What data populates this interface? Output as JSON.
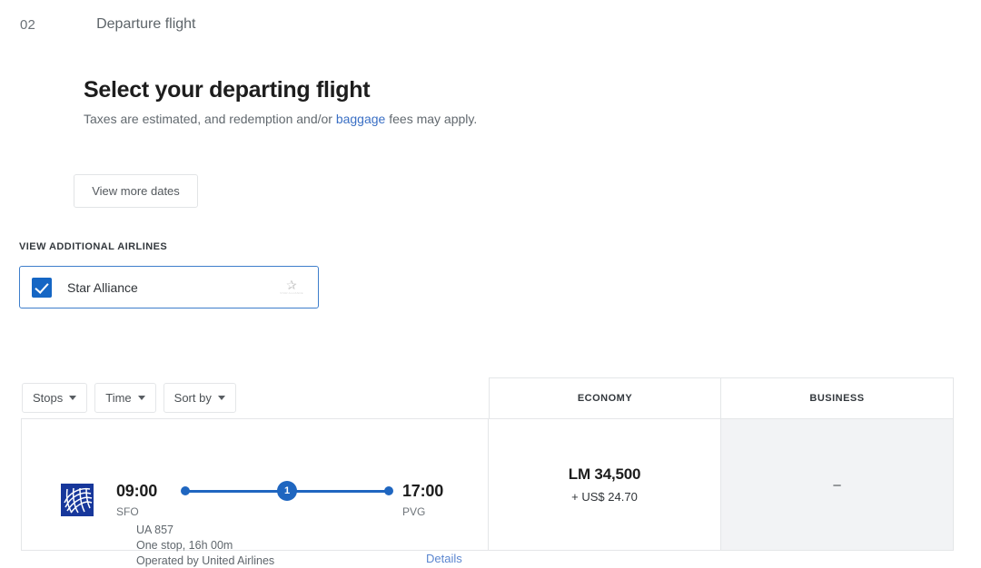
{
  "step": {
    "number": "02",
    "label": "Departure flight"
  },
  "header": {
    "title": "Select your departing flight",
    "subtitle_before": "Taxes are estimated, and redemption and/or ",
    "subtitle_link": "baggage",
    "subtitle_after": " fees may apply."
  },
  "actions": {
    "view_more_dates": "View more dates"
  },
  "airlines": {
    "section_label": "VIEW ADDITIONAL AIRLINES",
    "option": {
      "name": "Star Alliance",
      "checked": true,
      "logo_icon": "star-alliance-logo",
      "logo_word": "STAR ALLIANCE"
    }
  },
  "filters": [
    {
      "label": "Stops",
      "icon": "chevron-down-icon"
    },
    {
      "label": "Time",
      "icon": "chevron-down-icon"
    },
    {
      "label": "Sort by",
      "icon": "chevron-down-icon"
    }
  ],
  "fare_columns": [
    {
      "label": "ECONOMY"
    },
    {
      "label": "BUSINESS"
    }
  ],
  "flights": [
    {
      "airline_logo": "united-airlines-logo",
      "depart_time": "09:00",
      "depart_airport": "SFO",
      "arrive_time": "17:00",
      "arrive_airport": "PVG",
      "stops_badge": "1",
      "flight_number": "UA 857",
      "duration_line": "One stop, 16h 00m",
      "operated_by": "Operated by United Airlines",
      "details_label": "Details",
      "fares": {
        "economy": {
          "available": true,
          "miles": "LM 34,500",
          "tax": "+ US$ 24.70"
        },
        "business": {
          "available": false,
          "placeholder": "–"
        }
      }
    }
  ],
  "colors": {
    "accent_blue": "#1566c4",
    "path_blue": "#1f66c0",
    "link_blue": "#3a6fc4",
    "border_grey": "#e4e6e8",
    "unavailable_bg": "#f2f3f5"
  }
}
